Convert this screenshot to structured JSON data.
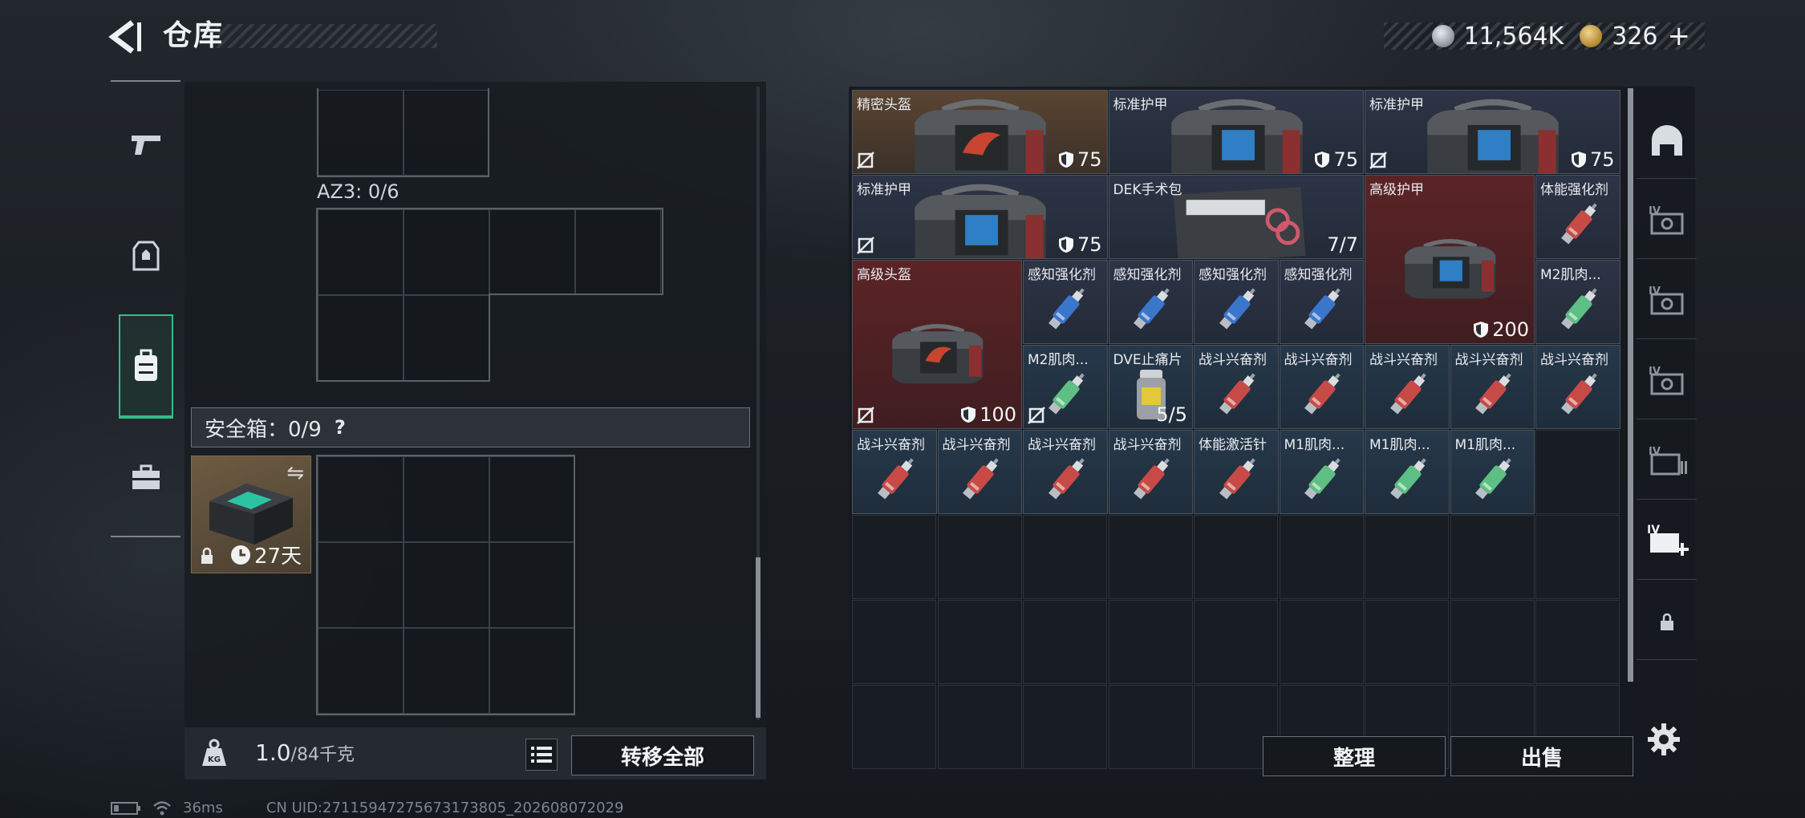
{
  "header": {
    "title": "仓库"
  },
  "currency": {
    "silver": "11,564K",
    "gold": "326",
    "plus": "+"
  },
  "left": {
    "az3_label": "AZ3: 0/6",
    "safe_label": "安全箱：0/9",
    "help": "?",
    "safebox_timer": "27天",
    "weight_value": "1.0",
    "weight_max": "/84千克",
    "transfer_all": "转移全部"
  },
  "items": [
    {
      "name": "精密头盔",
      "value": "75",
      "kind": "helmet",
      "bg": "brown",
      "shield": true,
      "nocell": true
    },
    {
      "name": "标准护甲",
      "value": "75",
      "kind": "armor",
      "bg": "navy",
      "shield": true,
      "nocell": false
    },
    {
      "name": "标准护甲",
      "value": "75",
      "kind": "armor",
      "bg": "navy",
      "shield": true,
      "nocell": true
    },
    {
      "name": "标准护甲",
      "value": "75",
      "kind": "armor",
      "bg": "navy",
      "shield": true,
      "nocell": true
    },
    {
      "name": "DEK手术包",
      "value": "7/7",
      "kind": "medkit",
      "bg": "navy",
      "shield": false,
      "nocell": false
    },
    {
      "name": "高级护甲",
      "value": "200",
      "kind": "armor",
      "bg": "red",
      "shield": true,
      "nocell": false
    },
    {
      "name": "体能强化剂",
      "value": "",
      "kind": "inj-red",
      "bg": "navy",
      "shield": false,
      "nocell": false
    },
    {
      "name": "高级头盔",
      "value": "100",
      "kind": "helmet",
      "bg": "red",
      "shield": true,
      "nocell": true
    },
    {
      "name": "感知强化剂",
      "value": "",
      "kind": "inj-blue",
      "bg": "navy"
    },
    {
      "name": "感知强化剂",
      "value": "",
      "kind": "inj-blue",
      "bg": "navy"
    },
    {
      "name": "感知强化剂",
      "value": "",
      "kind": "inj-blue",
      "bg": "navy"
    },
    {
      "name": "感知强化剂",
      "value": "",
      "kind": "inj-blue",
      "bg": "navy"
    },
    {
      "name": "M2肌肉...",
      "value": "",
      "kind": "inj-green",
      "bg": "navy"
    },
    {
      "name": "M2肌肉...",
      "value": "",
      "kind": "inj-green",
      "bg": "teal",
      "nocell": true
    },
    {
      "name": "DVE止痛片",
      "value": "5/5",
      "kind": "pills",
      "bg": "teal"
    },
    {
      "name": "战斗兴奋剂",
      "value": "",
      "kind": "inj-red",
      "bg": "teal"
    },
    {
      "name": "战斗兴奋剂",
      "value": "",
      "kind": "inj-red",
      "bg": "teal"
    },
    {
      "name": "战斗兴奋剂",
      "value": "",
      "kind": "inj-red",
      "bg": "teal"
    },
    {
      "name": "战斗兴奋剂",
      "value": "",
      "kind": "inj-red",
      "bg": "teal"
    },
    {
      "name": "战斗兴奋剂",
      "value": "",
      "kind": "inj-red",
      "bg": "teal"
    },
    {
      "name": "战斗兴奋剂",
      "value": "",
      "kind": "inj-red",
      "bg": "teal"
    },
    {
      "name": "战斗兴奋剂",
      "value": "",
      "kind": "inj-red",
      "bg": "teal"
    },
    {
      "name": "战斗兴奋剂",
      "value": "",
      "kind": "inj-red",
      "bg": "teal"
    },
    {
      "name": "战斗兴奋剂",
      "value": "",
      "kind": "inj-red",
      "bg": "teal"
    },
    {
      "name": "体能激活针",
      "value": "",
      "kind": "inj-red",
      "bg": "teal"
    },
    {
      "name": "M1肌肉...",
      "value": "",
      "kind": "inj-green",
      "bg": "teal"
    },
    {
      "name": "M1肌肉...",
      "value": "",
      "kind": "inj-green",
      "bg": "teal"
    },
    {
      "name": "M1肌肉...",
      "value": "",
      "kind": "inj-green",
      "bg": "teal"
    }
  ],
  "buttons": {
    "sort": "整理",
    "sell": "出售"
  },
  "right_sidebar": [
    {
      "icon": "helmet-tab-icon"
    },
    {
      "icon": "case-iv-icon"
    },
    {
      "icon": "case-iv-icon"
    },
    {
      "icon": "case-iv-icon"
    },
    {
      "icon": "case-iv-storage-icon"
    },
    {
      "icon": "add-case-icon"
    },
    {
      "icon": "lock-icon"
    }
  ],
  "status": {
    "ping": "36ms",
    "uid": "CN UID:27115947275673173805_202608072029"
  },
  "colors": {
    "accent": "#2fbf8b",
    "red_item": "#5b2426",
    "brown_item": "#5a4532",
    "navy_item": "#2d3446"
  }
}
